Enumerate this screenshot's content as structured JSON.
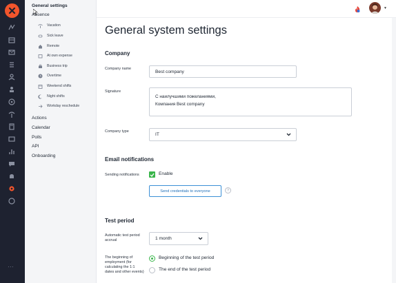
{
  "nav": {
    "general_settings": "General settings",
    "absence": "Absence",
    "absence_items": [
      {
        "label": "Vacation",
        "icon": "palm-tree-icon"
      },
      {
        "label": "Sick leave",
        "icon": "pill-icon"
      },
      {
        "label": "Remote",
        "icon": "home-icon"
      },
      {
        "label": "At own expense",
        "icon": "wallet-icon"
      },
      {
        "label": "Business trip",
        "icon": "briefcase-icon"
      },
      {
        "label": "Overtime",
        "icon": "clock-icon"
      },
      {
        "label": "Weekend shifts",
        "icon": "calendar-icon"
      },
      {
        "label": "Night shifts",
        "icon": "moon-icon"
      },
      {
        "label": "Workday reschedule",
        "icon": "arrow-right-icon"
      }
    ],
    "actions": "Actions",
    "calendar": "Calendar",
    "polls": "Polls",
    "api": "API",
    "onboarding": "Onboarding"
  },
  "page_title": "General system settings",
  "company": {
    "heading": "Company",
    "name_label": "Company name",
    "name_value": "Best company",
    "signature_label": "Signature",
    "signature_line1": "С наилучшими пожеланиями,",
    "signature_line2": "Компания Best company",
    "type_label": "Company type",
    "type_value": "IT"
  },
  "email": {
    "heading": "Email notifications",
    "sending_label": "Sending notifications",
    "enable_label": "Enable",
    "send_button": "Send credentials to everyone",
    "help": "?"
  },
  "test_period": {
    "heading": "Test period",
    "accrual_label": "Automatic test period accrual",
    "accrual_value": "1 month",
    "beginning_label": "The beginning of employment (for calculating the 1:1 dates and other events)",
    "option_beginning": "Beginning of the test period",
    "option_end": "The end of the test period",
    "selected": "Beginning of the test period"
  },
  "rail": {
    "more": "…"
  },
  "colors": {
    "accent": "#39b54a",
    "brand": "#f2552c",
    "rail": "#1e2230",
    "link": "#3b8fd6"
  }
}
